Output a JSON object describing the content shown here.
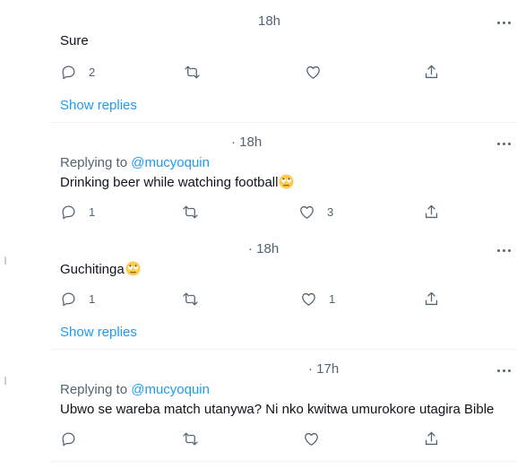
{
  "tweets": [
    {
      "time": "18h",
      "replying_label": "",
      "replying_handle": "",
      "text": "Sure",
      "reply_count": "2",
      "retweet_count": "",
      "like_count": "",
      "show_replies": "Show replies"
    },
    {
      "time": "· 18h",
      "replying_label": "Replying to ",
      "replying_handle": "@mucyoquin",
      "text": "Drinking beer while watching football",
      "reply_count": "1",
      "retweet_count": "",
      "like_count": "3",
      "show_replies": ""
    },
    {
      "time": "· 18h",
      "replying_label": "",
      "replying_handle": "",
      "text": "Guchitinga",
      "reply_count": "1",
      "retweet_count": "",
      "like_count": "1",
      "show_replies": "Show replies"
    },
    {
      "time": "· 17h",
      "replying_label": "Replying to ",
      "replying_handle": "@mucyoquin",
      "text": "Ubwo se wareba match utanywa? Ni nko kwitwa umurokore utagira Bible",
      "reply_count": "",
      "retweet_count": "",
      "like_count": "",
      "show_replies": ""
    }
  ],
  "icons": {
    "reply": "reply-icon",
    "retweet": "retweet-icon",
    "like": "heart-icon",
    "share": "share-icon",
    "more": "more-icon",
    "emoji": "face-with-rolling-eyes-emoji"
  },
  "colors": {
    "link": "#1d9bf0",
    "muted": "#536471",
    "text": "#0f1419",
    "divider": "#eff3f4"
  }
}
